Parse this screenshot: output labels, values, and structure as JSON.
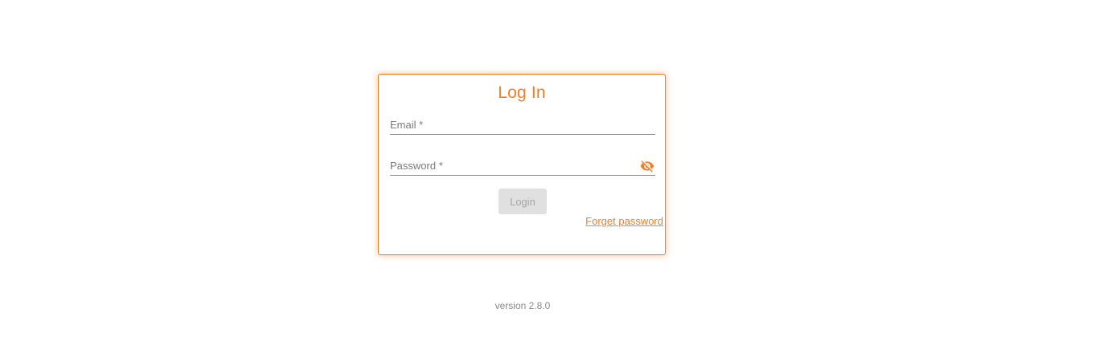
{
  "login": {
    "title": "Log In",
    "email_placeholder": "Email *",
    "email_value": "",
    "password_placeholder": "Password *",
    "password_value": "",
    "password_toggle_icon": "eye-off-icon",
    "login_label": "Login",
    "forget_password_label": "Forget password"
  },
  "footer": {
    "version": "version 2.8.0"
  },
  "colors": {
    "accent": "#f07f2a",
    "button_disabled_bg": "#e0e0e0",
    "button_disabled_text": "#a6a6a6",
    "muted_text": "#8a8a8a"
  }
}
